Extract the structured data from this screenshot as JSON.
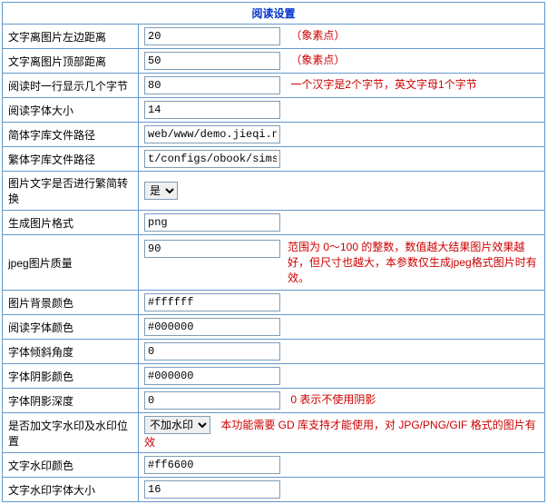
{
  "header": "阅读设置",
  "rows": {
    "left_margin": {
      "label": "文字离图片左边距离",
      "value": "20",
      "desc": "（象素点）"
    },
    "top_margin": {
      "label": "文字离图片顶部距离",
      "value": "50",
      "desc": "（象素点）"
    },
    "bytes_per_line": {
      "label": "阅读时一行显示几个字节",
      "value": "80",
      "desc": "一个汉字是2个字节，英文字母1个字节"
    },
    "font_size": {
      "label": "阅读字体大小",
      "value": "14"
    },
    "simp_font_path": {
      "label": "简体字库文件路径",
      "value": "web/www/demo.jieqi.net/con"
    },
    "trad_font_path": {
      "label": "繁体字库文件路径",
      "value": "t/configs/obook/simsun.ttc"
    },
    "convert": {
      "label": "图片文字是否进行繁简转换",
      "selected": "是"
    },
    "img_format": {
      "label": "生成图片格式",
      "value": "png"
    },
    "jpeg_quality": {
      "label": "jpeg图片质量",
      "value": "90",
      "desc": "范围为 0～100 的整数，数值越大结果图片效果越好，但尺寸也越大，本参数仅生成jpeg格式图片时有效。"
    },
    "bg_color": {
      "label": "图片背景颜色",
      "value": "#ffffff"
    },
    "font_color": {
      "label": "阅读字体颜色",
      "value": "#000000"
    },
    "font_angle": {
      "label": "字体倾斜角度",
      "value": "0"
    },
    "shadow_color": {
      "label": "字体阴影颜色",
      "value": "#000000"
    },
    "shadow_depth": {
      "label": "字体阴影深度",
      "value": "0",
      "desc": "0 表示不使用阴影"
    },
    "watermark": {
      "label": "是否加文字水印及水印位置",
      "selected": "不加水印",
      "desc": "本功能需要 GD 库支持才能使用，对 JPG/PNG/GIF 格式的图片有效"
    },
    "wm_color": {
      "label": "文字水印颜色",
      "value": "#ff6600"
    },
    "wm_font_size": {
      "label": "文字水印字体大小",
      "value": "16"
    }
  }
}
